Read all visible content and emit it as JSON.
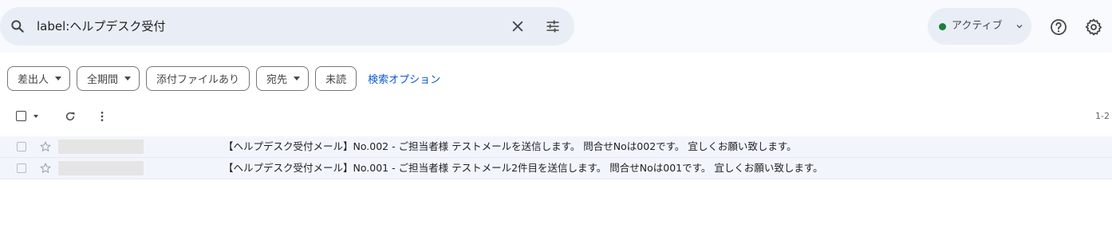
{
  "search": {
    "query": "label:ヘルプデスク受付"
  },
  "status": {
    "label": "アクティブ",
    "color": "#188038"
  },
  "filters": [
    {
      "label": "差出人",
      "has_caret": true
    },
    {
      "label": "全期間",
      "has_caret": true
    },
    {
      "label": "添付ファイルあり",
      "has_caret": false
    },
    {
      "label": "宛先",
      "has_caret": true
    },
    {
      "label": "未読",
      "has_caret": false
    }
  ],
  "search_options_label": "検索オプション",
  "toolbar": {
    "range": "1-2"
  },
  "icons": {
    "search": "search-icon",
    "clear": "close-icon",
    "tune": "tune-icon",
    "help": "help-icon",
    "settings": "gear-icon",
    "refresh": "refresh-icon",
    "more": "more-vert-icon",
    "star": "star-icon"
  },
  "emails": [
    {
      "subject": "【ヘルプデスク受付メール】No.002",
      "separator": " - ",
      "snippet": "ご担当者様 テストメールを送信します。 問合せNoは002です。 宜しくお願い致します。"
    },
    {
      "subject": "【ヘルプデスク受付メール】No.001",
      "separator": " - ",
      "snippet": "ご担当者様 テストメール2件目を送信します。 問合せNoは001です。 宜しくお願い致します。"
    }
  ]
}
